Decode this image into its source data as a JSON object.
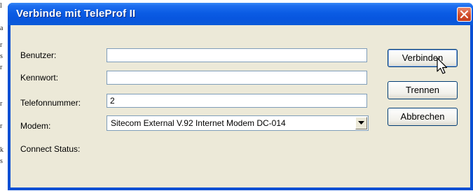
{
  "window": {
    "title": "Verbinde mit TeleProf II"
  },
  "form": {
    "user_label": "Benutzer:",
    "user_value": "",
    "password_label": "Kennwort:",
    "password_value": "",
    "phone_label": "Telefonnummer:",
    "phone_value": "2",
    "modem_label": "Modem:",
    "modem_value": "Sitecom External V.92 Internet Modem DC-014",
    "status_label": "Connect Status:"
  },
  "buttons": {
    "connect": "Verbinden",
    "disconnect": "Trennen",
    "cancel": "Abbrechen"
  },
  "edge_fragments": [
    "l",
    "a",
    "r",
    "s",
    "r",
    "r",
    "r",
    "k",
    "s"
  ],
  "colors": {
    "titlebar": "#0b5ce4",
    "close": "#d04a26",
    "client": "#ece9d8"
  },
  "icons": {
    "close": "close-icon",
    "dropdown": "chevron-down-icon",
    "cursor": "mouse-pointer-icon"
  }
}
